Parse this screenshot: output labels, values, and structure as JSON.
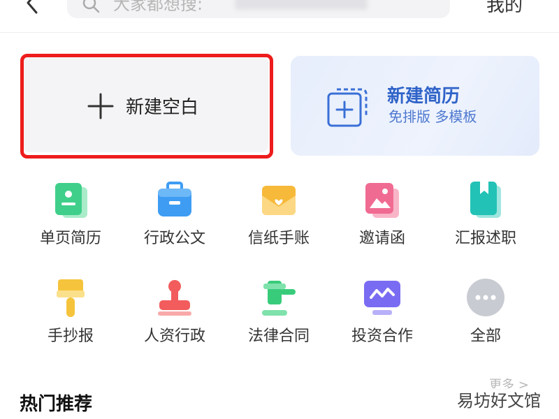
{
  "header": {
    "search_placeholder": "大家都想搜:",
    "mine_label": "我的"
  },
  "cards": {
    "blank_label": "新建空白",
    "resume_title": "新建简历",
    "resume_subtitle": "免排版 多模板"
  },
  "categories": [
    {
      "label": "单页简历",
      "icon": "resume-icon",
      "color": "#3fcf8a"
    },
    {
      "label": "行政公文",
      "icon": "briefcase-icon",
      "color": "#3e9cf3"
    },
    {
      "label": "信纸手账",
      "icon": "envelope-icon",
      "color": "#f7b93a"
    },
    {
      "label": "邀请函",
      "icon": "picture-icon",
      "color": "#f06b92"
    },
    {
      "label": "汇报述职",
      "icon": "bookmark-book-icon",
      "color": "#22c2b6"
    },
    {
      "label": "手抄报",
      "icon": "paint-brush-icon",
      "color": "#f5c43c"
    },
    {
      "label": "人资行政",
      "icon": "stamp-icon",
      "color": "#f25c5c"
    },
    {
      "label": "法律合同",
      "icon": "gavel-icon",
      "color": "#38cc7a"
    },
    {
      "label": "投资合作",
      "icon": "chart-monitor-icon",
      "color": "#7a6cf2"
    },
    {
      "label": "全部",
      "icon": "more-dots-icon",
      "color": "#c9cbd2"
    }
  ],
  "more_label": "更多 >",
  "section": {
    "title": "热门推荐"
  },
  "watermark": "易坊好文馆"
}
